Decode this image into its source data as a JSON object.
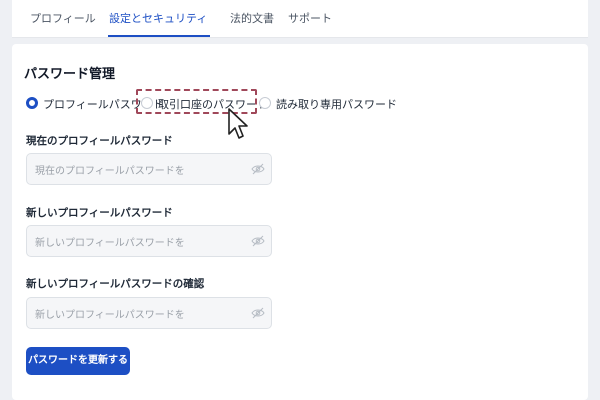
{
  "tabs": [
    {
      "label": "プロフィール"
    },
    {
      "label": "設定とセキュリティ"
    },
    {
      "label": "法的文書"
    },
    {
      "label": "サポート"
    }
  ],
  "active_tab": "設定とセキュリティ",
  "section": {
    "title": "パスワード管理",
    "options": [
      {
        "label": "プロフィールパスワード",
        "selected": true
      },
      {
        "label": "取引口座のパスワード",
        "selected": false
      },
      {
        "label": "読み取り専用パスワード",
        "selected": false
      }
    ]
  },
  "fields": [
    {
      "label": "現在のプロフィールパスワード",
      "placeholder": "現在のプロフィールパスワードを入力し",
      "icon": "eye-off-icon"
    },
    {
      "label": "新しいプロフィールパスワード",
      "placeholder": "新しいプロフィールパスワードを入力して",
      "icon": "eye-off-icon"
    },
    {
      "label": "新しいプロフィールパスワードの確認",
      "placeholder": "新しいプロフィールパスワードを再入力",
      "icon": "eye-off-icon"
    }
  ],
  "submit_label": "パスワードを更新する",
  "colors": {
    "accent": "#1d4fc4",
    "highlight": "#a0485a"
  }
}
